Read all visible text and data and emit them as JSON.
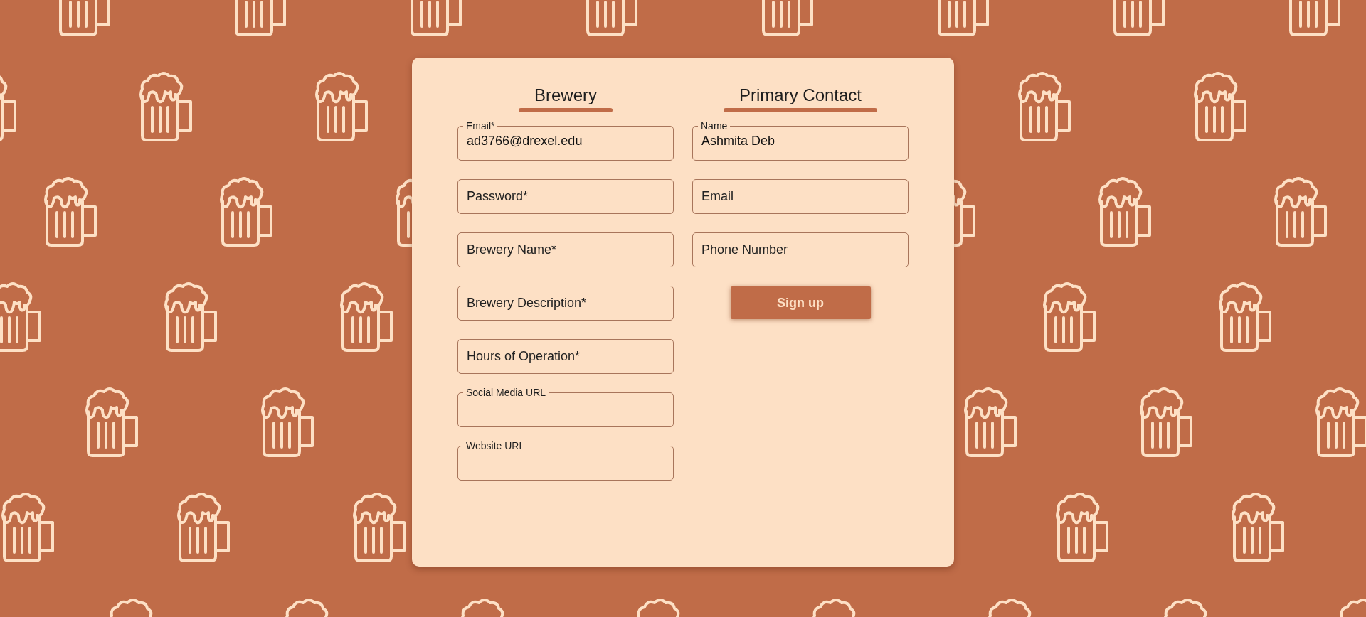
{
  "sections": [
    {
      "heading": "Brewery",
      "fields": [
        {
          "label": "Email*",
          "value": "ad3766@drexel.edu"
        },
        {
          "placeholder": "Password*"
        },
        {
          "placeholder": "Brewery Name*"
        },
        {
          "placeholder": "Brewery Description*"
        },
        {
          "placeholder": "Hours of Operation*"
        },
        {
          "label": "Social Media URL"
        },
        {
          "label": "Website URL"
        }
      ]
    },
    {
      "heading": "Primary Contact",
      "fields": [
        {
          "label": "Name",
          "value": "Ashmita Deb"
        },
        {
          "placeholder": "Email"
        },
        {
          "placeholder": "Phone Number"
        }
      ],
      "button": "Sign up"
    }
  ]
}
